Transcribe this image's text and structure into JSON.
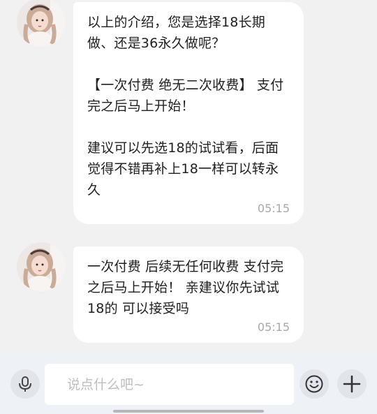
{
  "messages": [
    {
      "text": "以上的介绍，您是选择18长期做、还是36永久做呢？\n\n【一次付费 绝无二次收费】 支付完之后马上开始！\n\n建议可以先选18的试试看，后面觉得不错再补上18一样可以转永久",
      "time": "05:15"
    },
    {
      "text": "一次付费 后续无任何收费 支付完之后马上开始！ 亲建议你先试试18的 可以接受吗",
      "time": "05:15"
    }
  ],
  "input": {
    "placeholder": "说点什么吧~"
  },
  "icons": {
    "mic": "microphone-icon",
    "emoji": "smiley-face-icon",
    "plus": "plus-icon"
  },
  "colors": {
    "background": "#f1f1f1",
    "bubble": "#ffffff",
    "input_bar": "#eef1f6",
    "timestamp": "#a7a7a7"
  }
}
